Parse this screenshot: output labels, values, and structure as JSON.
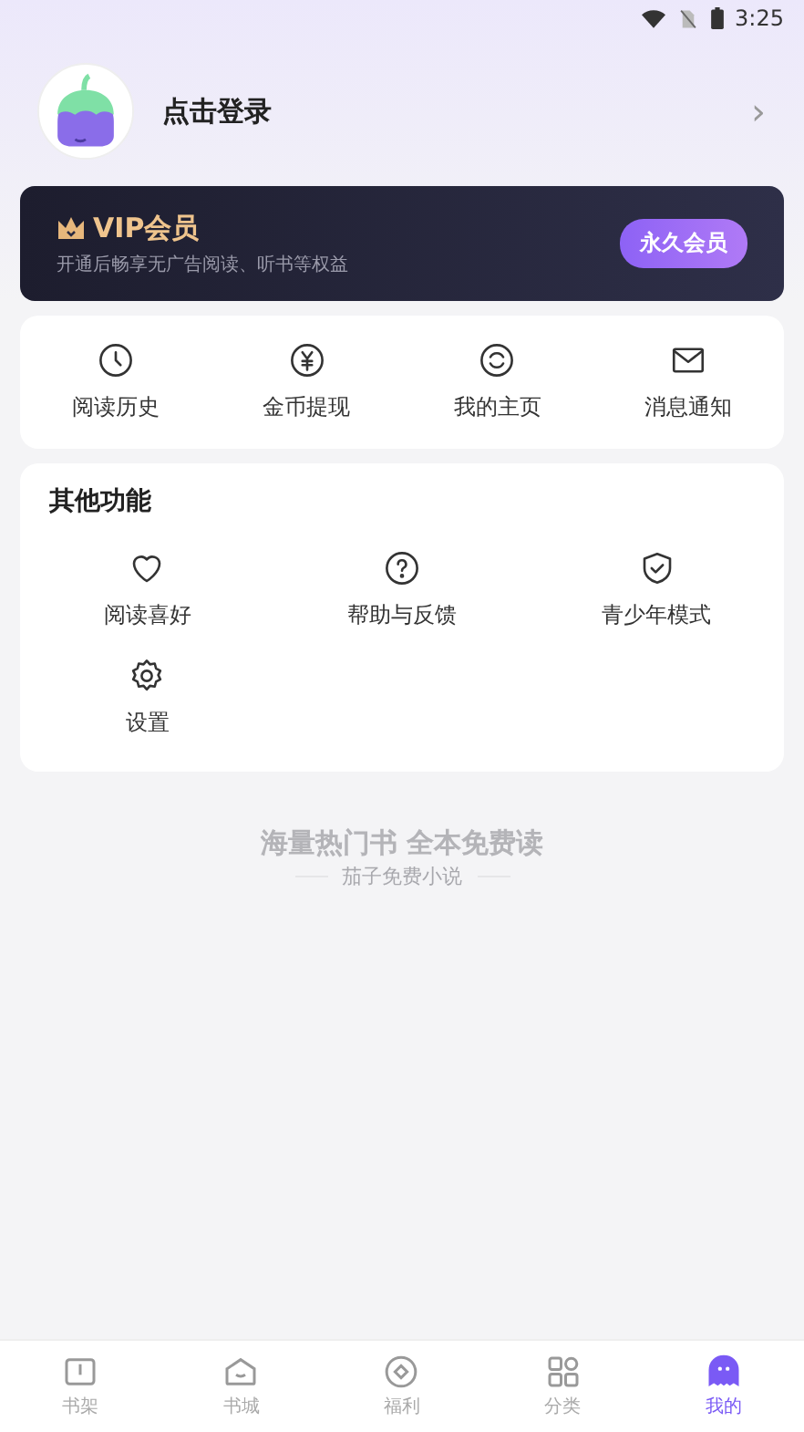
{
  "status_bar": {
    "time": "3:25"
  },
  "profile": {
    "login": "点击登录",
    "chevron": "›"
  },
  "vip": {
    "title": "VIP会员",
    "subtitle": "开通后畅享无广告阅读、听书等权益",
    "button": "永久会员"
  },
  "quick_actions": [
    {
      "label": "阅读历史"
    },
    {
      "label": "金币提现"
    },
    {
      "label": "我的主页"
    },
    {
      "label": "消息通知"
    }
  ],
  "other": {
    "title": "其他功能",
    "items": [
      {
        "label": "阅读喜好"
      },
      {
        "label": "帮助与反馈"
      },
      {
        "label": "青少年模式"
      },
      {
        "label": "设置"
      }
    ]
  },
  "slogan": {
    "headline": "海量热门书 全本免费读",
    "brand": "茄子免费小说"
  },
  "tabs": [
    {
      "label": "书架",
      "selected": false
    },
    {
      "label": "书城",
      "selected": false
    },
    {
      "label": "福利",
      "selected": false
    },
    {
      "label": "分类",
      "selected": false
    },
    {
      "label": "我的",
      "selected": true
    }
  ]
}
